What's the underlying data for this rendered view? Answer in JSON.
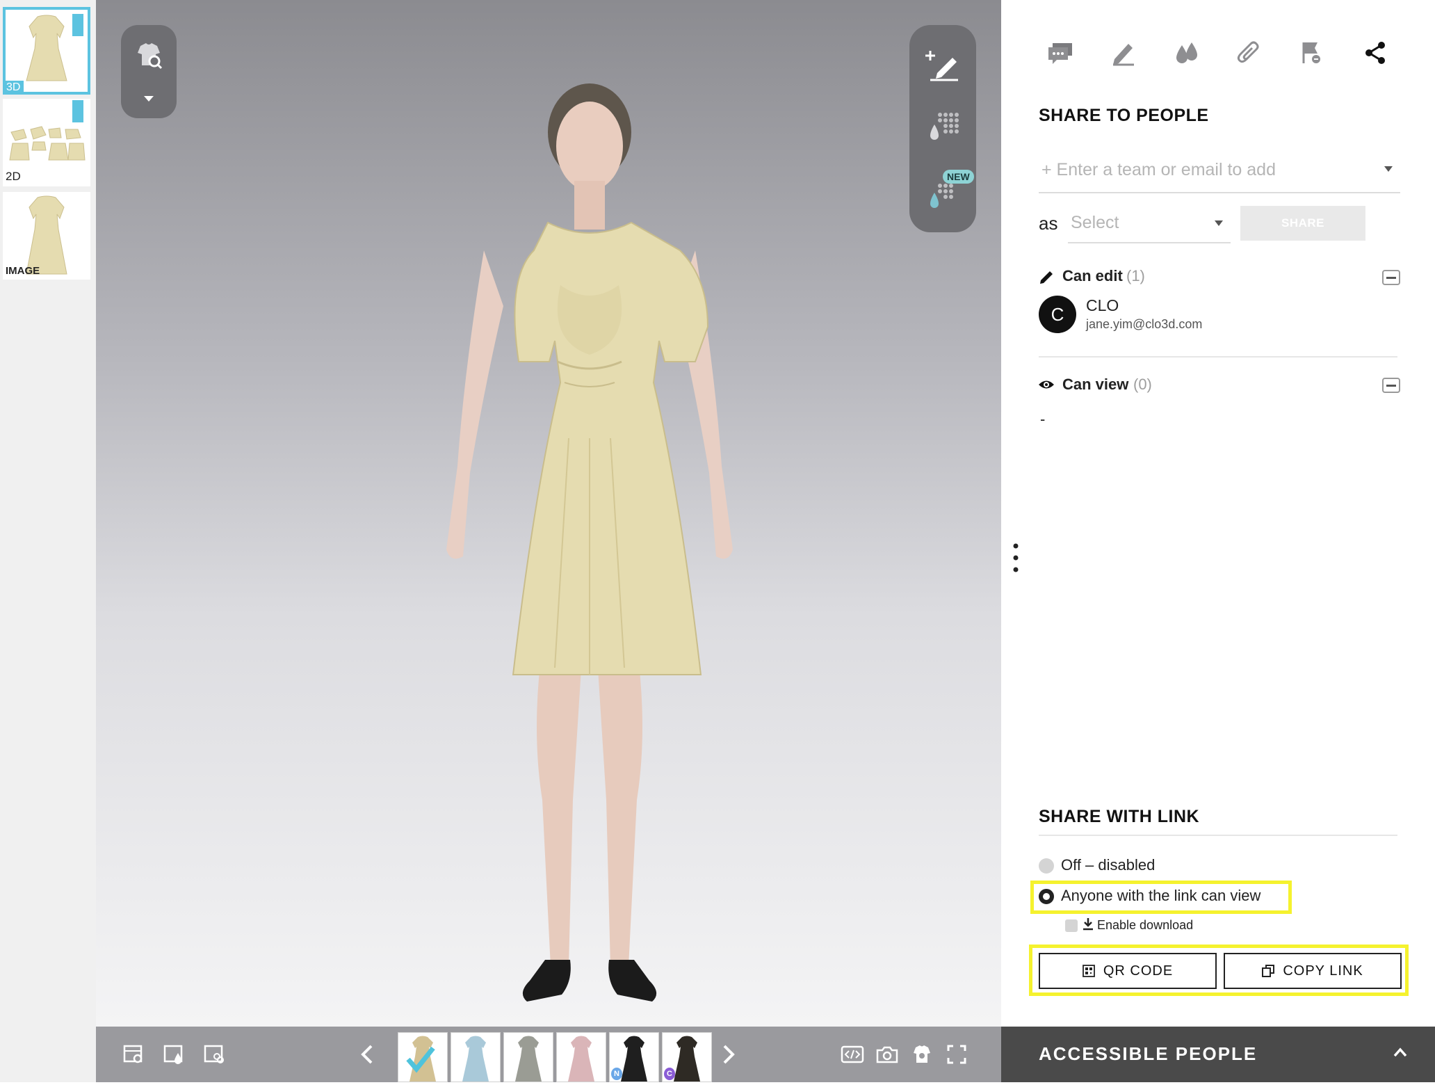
{
  "thumbnails": [
    {
      "label": "3D"
    },
    {
      "label": "2D"
    },
    {
      "label": "IMAGE"
    }
  ],
  "viewport": {
    "left_tool": {
      "icon": "garment-search-icon",
      "dropdown": "chevron-down-icon"
    },
    "right_tools": [
      {
        "icon": "add-annotation-icon"
      },
      {
        "icon": "colorway-grid-icon"
      },
      {
        "icon": "colorway-grid-new-icon",
        "badge": "NEW"
      }
    ],
    "background_top": "#8b8b90",
    "background_bottom": "#f4f4f5",
    "garment_color": "#e5dcb0"
  },
  "bottom_bar": {
    "left_icons": [
      "scene-settings-icon",
      "fabric-icon",
      "colorway-icon"
    ],
    "prev": "chevron-left-icon",
    "next": "chevron-right-icon",
    "colorways": [
      {
        "color": "#d2c193",
        "selected": true,
        "marker": ""
      },
      {
        "color": "#a9c9d9",
        "selected": false,
        "marker": ""
      },
      {
        "color": "#9a9c94",
        "selected": false,
        "marker": ""
      },
      {
        "color": "#dab5b8",
        "selected": false,
        "marker": ""
      },
      {
        "color": "#1f1f1f",
        "selected": false,
        "marker": "N"
      },
      {
        "color": "#2e2a24",
        "selected": false,
        "marker": "C"
      }
    ],
    "right_icons": [
      "embed-code-icon",
      "camera-icon",
      "avatar-camera-icon",
      "fullscreen-icon"
    ]
  },
  "panel": {
    "top_icons": [
      "comment-icon",
      "edit-icon",
      "colorway-drops-icon",
      "attachment-icon",
      "flag-link-icon",
      "share-icon"
    ],
    "share_to_people": {
      "title": "SHARE TO PEOPLE",
      "input_placeholder": "+ Enter a team or email to add",
      "as_label": "as",
      "role_placeholder": "Select",
      "share_button": "SHARE"
    },
    "can_edit": {
      "label": "Can edit",
      "count": "(1)",
      "members": [
        {
          "initial": "C",
          "name": "CLO",
          "email": "jane.yim@clo3d.com"
        }
      ]
    },
    "can_view": {
      "label": "Can view",
      "count": "(0)",
      "empty": "-"
    },
    "share_with_link": {
      "title": "SHARE WITH LINK",
      "option_off": "Off – disabled",
      "option_anyone": "Anyone with the link can view",
      "enable_download": "Enable download",
      "qr_button": "QR CODE",
      "copy_button": "COPY LINK"
    },
    "accessible_people": "ACCESSIBLE PEOPLE",
    "highlight_color": "#f5f22e",
    "accent_color": "#5cc3e0"
  }
}
